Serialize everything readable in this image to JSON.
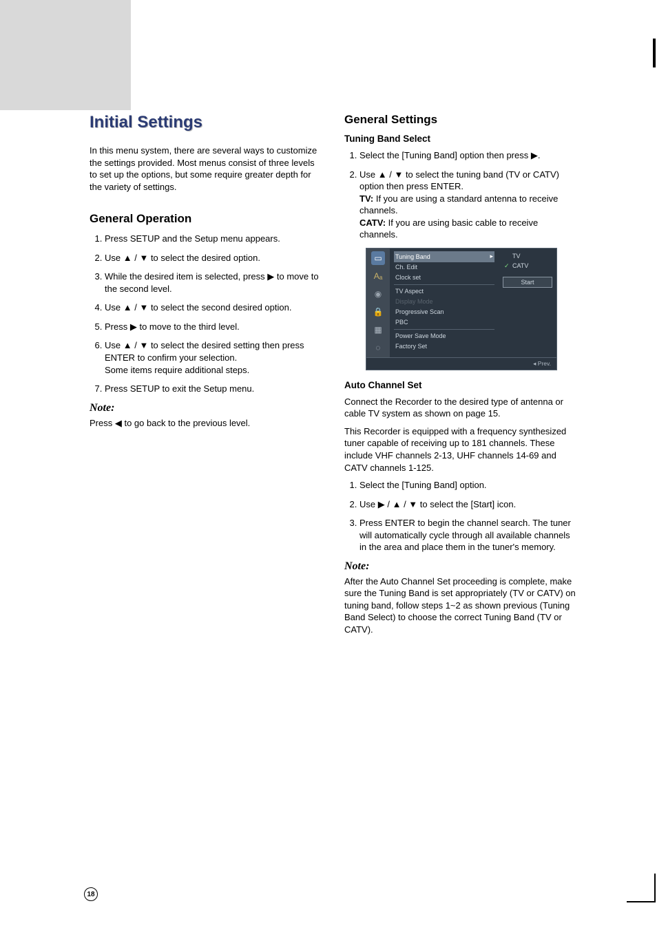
{
  "page_number": "18",
  "title": "Initial Settings",
  "intro": "In this menu system, there are several ways to customize the settings provided. Most menus consist of three levels to set up the options, but some require greater depth for the variety of settings.",
  "left": {
    "section": "General Operation",
    "steps": {
      "s1": "Press SETUP and the Setup menu appears.",
      "s2a": "Use ",
      "s2b": " to select the desired option.",
      "s3a": "While the desired item is selected, press ",
      "s3b": " to move to the second level.",
      "s4a": "Use ",
      "s4b": " to select the second desired option.",
      "s5a": "Press ",
      "s5b": " to move to the third level.",
      "s6a": "Use ",
      "s6b": " to select the desired setting then press ENTER to confirm your selection.",
      "s6c": "Some items require additional steps.",
      "s7": "Press SETUP to exit the Setup menu."
    },
    "note_head": "Note:",
    "note_a": "Press ",
    "note_b": " to go back to the previous level."
  },
  "right": {
    "section": "General Settings",
    "tuning": {
      "heading": "Tuning Band Select",
      "s1a": "Select the [Tuning Band] option then press ",
      "s1b": ".",
      "s2a": "Use ",
      "s2b": " to select the tuning band (TV or CATV)  option then press ENTER.",
      "s2_tv_label": "TV:",
      "s2_tv": " If you are using a standard antenna to receive channels.",
      "s2_catv_label": "CATV:",
      "s2_catv": " If you are using basic cable to receive channels."
    },
    "osd": {
      "mid": {
        "tuning": "Tuning Band",
        "chedit": "Ch. Edit",
        "clock": "Clock set",
        "aspect": "TV Aspect",
        "display": "Display Mode",
        "prog": "Progressive Scan",
        "pbc": "PBC",
        "psave": "Power Save Mode",
        "factory": "Factory Set"
      },
      "right": {
        "tv": "TV",
        "catv": "CATV",
        "start": "Start"
      },
      "prev": "Prev."
    },
    "auto": {
      "heading": "Auto Channel Set",
      "p1": "Connect the Recorder to the desired type of antenna or cable TV system as shown on page 15.",
      "p2": "This Recorder is equipped with a frequency synthesized tuner capable of receiving up to 181 channels. These include VHF channels 2-13, UHF channels 14-69 and CATV channels 1-125.",
      "s1": "Select the [Tuning Band] option.",
      "s2a": "Use ",
      "s2b": " to select the [Start] icon.",
      "s3": "Press ENTER to begin the channel search. The tuner will automatically cycle through all available channels in the area and place them in the tuner's memory."
    },
    "note_head": "Note:",
    "note_body": "After the Auto Channel Set proceeding is complete, make sure the Tuning Band is set appropriately (TV or CATV) on tuning band, follow steps 1~2 as shown previous (Tuning Band Select) to choose the correct Tuning Band (TV or CATV)."
  },
  "glyph": {
    "up": "▲",
    "down": "▼",
    "left": "◀",
    "right": "▶",
    "slash": " / "
  }
}
